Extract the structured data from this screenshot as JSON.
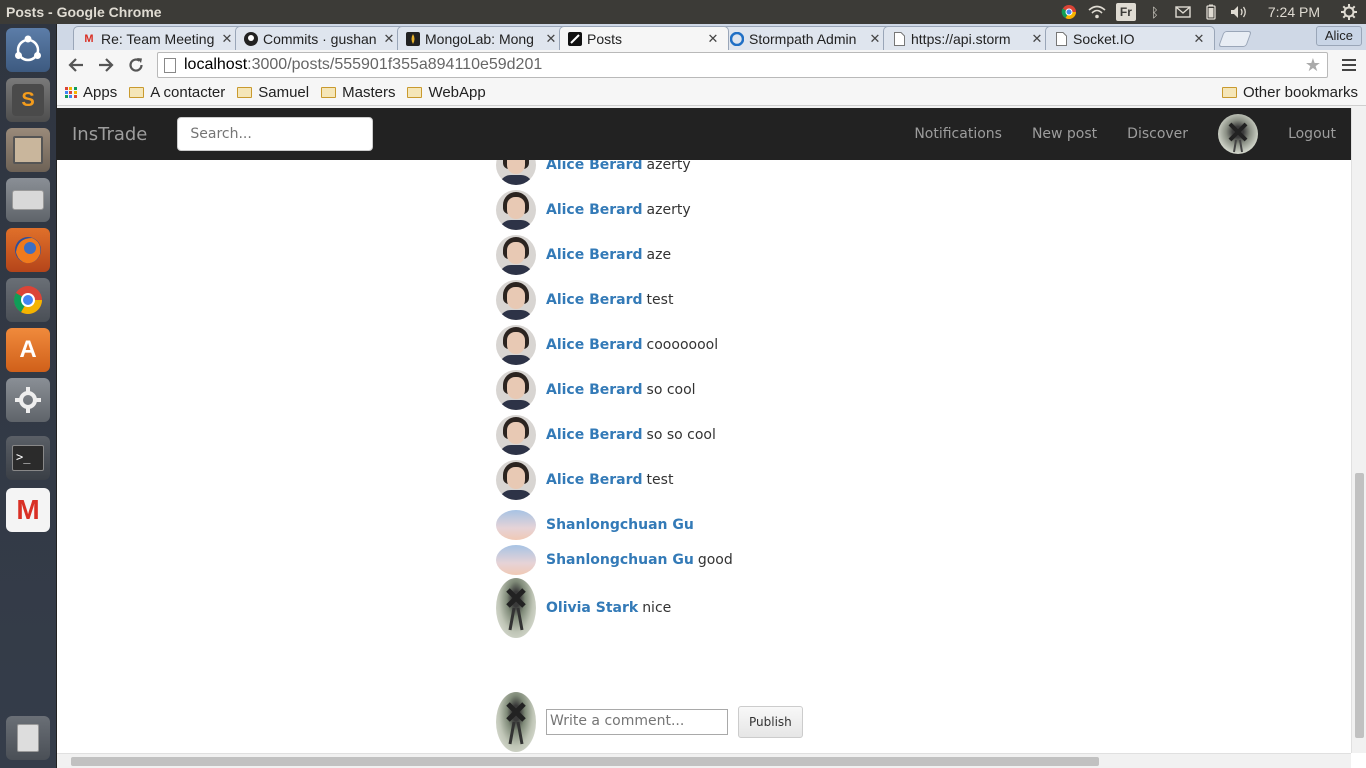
{
  "os": {
    "window_title": "Posts - Google Chrome",
    "keyboard_layout": "Fr",
    "clock": "7:24 PM"
  },
  "browser": {
    "profile": "Alice",
    "tabs": [
      {
        "label": "Re: Team Meeting",
        "icon": "gmail-icon",
        "active": false
      },
      {
        "label": "Commits · gushan",
        "icon": "github-icon",
        "active": false
      },
      {
        "label": "MongoLab: Mong",
        "icon": "mongolab-icon",
        "active": false
      },
      {
        "label": "Posts",
        "icon": "site-icon",
        "active": true
      },
      {
        "label": "Stormpath Admin",
        "icon": "stormpath-icon",
        "active": false
      },
      {
        "label": "https://api.storm",
        "icon": "page-icon",
        "active": false
      },
      {
        "label": "Socket.IO",
        "icon": "page-icon",
        "active": false
      }
    ],
    "url_host": "localhost",
    "url_path": ":3000/posts/555901f355a894110e59d201",
    "bookmarks": [
      "Apps",
      "A contacter",
      "Samuel",
      "Masters",
      "WebApp"
    ],
    "other_bookmarks": "Other bookmarks"
  },
  "navbar": {
    "brand": "InsTrade",
    "search_placeholder": "Search...",
    "links": [
      "Notifications",
      "New post",
      "Discover",
      "Logout"
    ]
  },
  "comments": [
    {
      "author": "Alice Berard",
      "text": "azerty",
      "avatar": "alice"
    },
    {
      "author": "Alice Berard",
      "text": "azerty",
      "avatar": "alice"
    },
    {
      "author": "Alice Berard",
      "text": "azerty",
      "avatar": "alice"
    },
    {
      "author": "Alice Berard",
      "text": "aze",
      "avatar": "alice"
    },
    {
      "author": "Alice Berard",
      "text": "test",
      "avatar": "alice"
    },
    {
      "author": "Alice Berard",
      "text": "coooooool",
      "avatar": "alice"
    },
    {
      "author": "Alice Berard",
      "text": "so cool",
      "avatar": "alice"
    },
    {
      "author": "Alice Berard",
      "text": "so so cool",
      "avatar": "alice"
    },
    {
      "author": "Alice Berard",
      "text": "test",
      "avatar": "alice"
    },
    {
      "author": "Shanlongchuan Gu",
      "text": "",
      "avatar": "shan"
    },
    {
      "author": "Shanlongchuan Gu",
      "text": "good",
      "avatar": "shan"
    },
    {
      "author": "Olivia Stark",
      "text": "nice",
      "avatar": "olivia"
    }
  ],
  "compose": {
    "placeholder": "Write a comment...",
    "publish_label": "Publish"
  }
}
